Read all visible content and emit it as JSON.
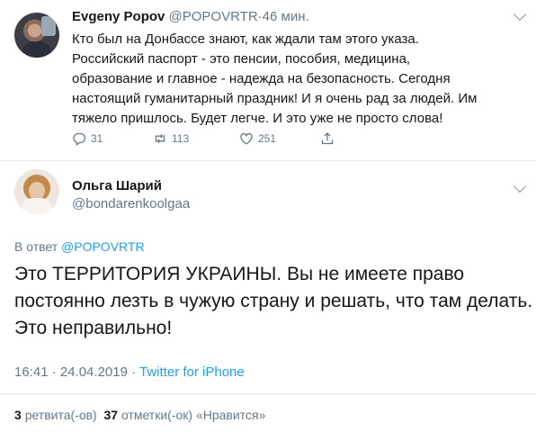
{
  "tweet1": {
    "name": "Evgeny Popov",
    "handle": "@POPOVRTR",
    "separator": "·",
    "time": "46 мин.",
    "lines": [
      "Кто был на Донбассе знают, как ждали там этого указа.",
      "Российский паспорт - это пенсии, пособия, медицина,",
      "образование и главное - надежда на безопасность. Сегодня",
      "настоящий гуманитарный праздник! И я очень рад за людей. Им",
      "тяжело пришлось. Будет легче. И это уже не просто слова!"
    ],
    "actions": {
      "replies": "31",
      "retweets": "113",
      "likes": "251"
    }
  },
  "tweet2": {
    "name": "Ольга Шарий",
    "handle": "@bondarenkoolgaa",
    "reply_prefix": "В ответ",
    "reply_to": "@POPOVRTR",
    "lines": [
      "Это ТЕРРИТОРИЯ УКРАИНЫ. Вы не имеете право",
      "постоянно лезть в чужую страну и решать, что там делать.",
      "Это неправильно!"
    ],
    "timestamp": "16:41 · 24.04.2019 ·",
    "source": "Twitter for iPhone",
    "retweets_count": "3",
    "retweets_label": "ретвита(-ов)",
    "likes_count": "37",
    "likes_label": "отметки(-ок) «Нравится»"
  },
  "colors": {
    "accent": "#1da1f2",
    "secondary_text": "#657786",
    "primary_text": "#14171a",
    "divider": "#e6ecf0"
  }
}
